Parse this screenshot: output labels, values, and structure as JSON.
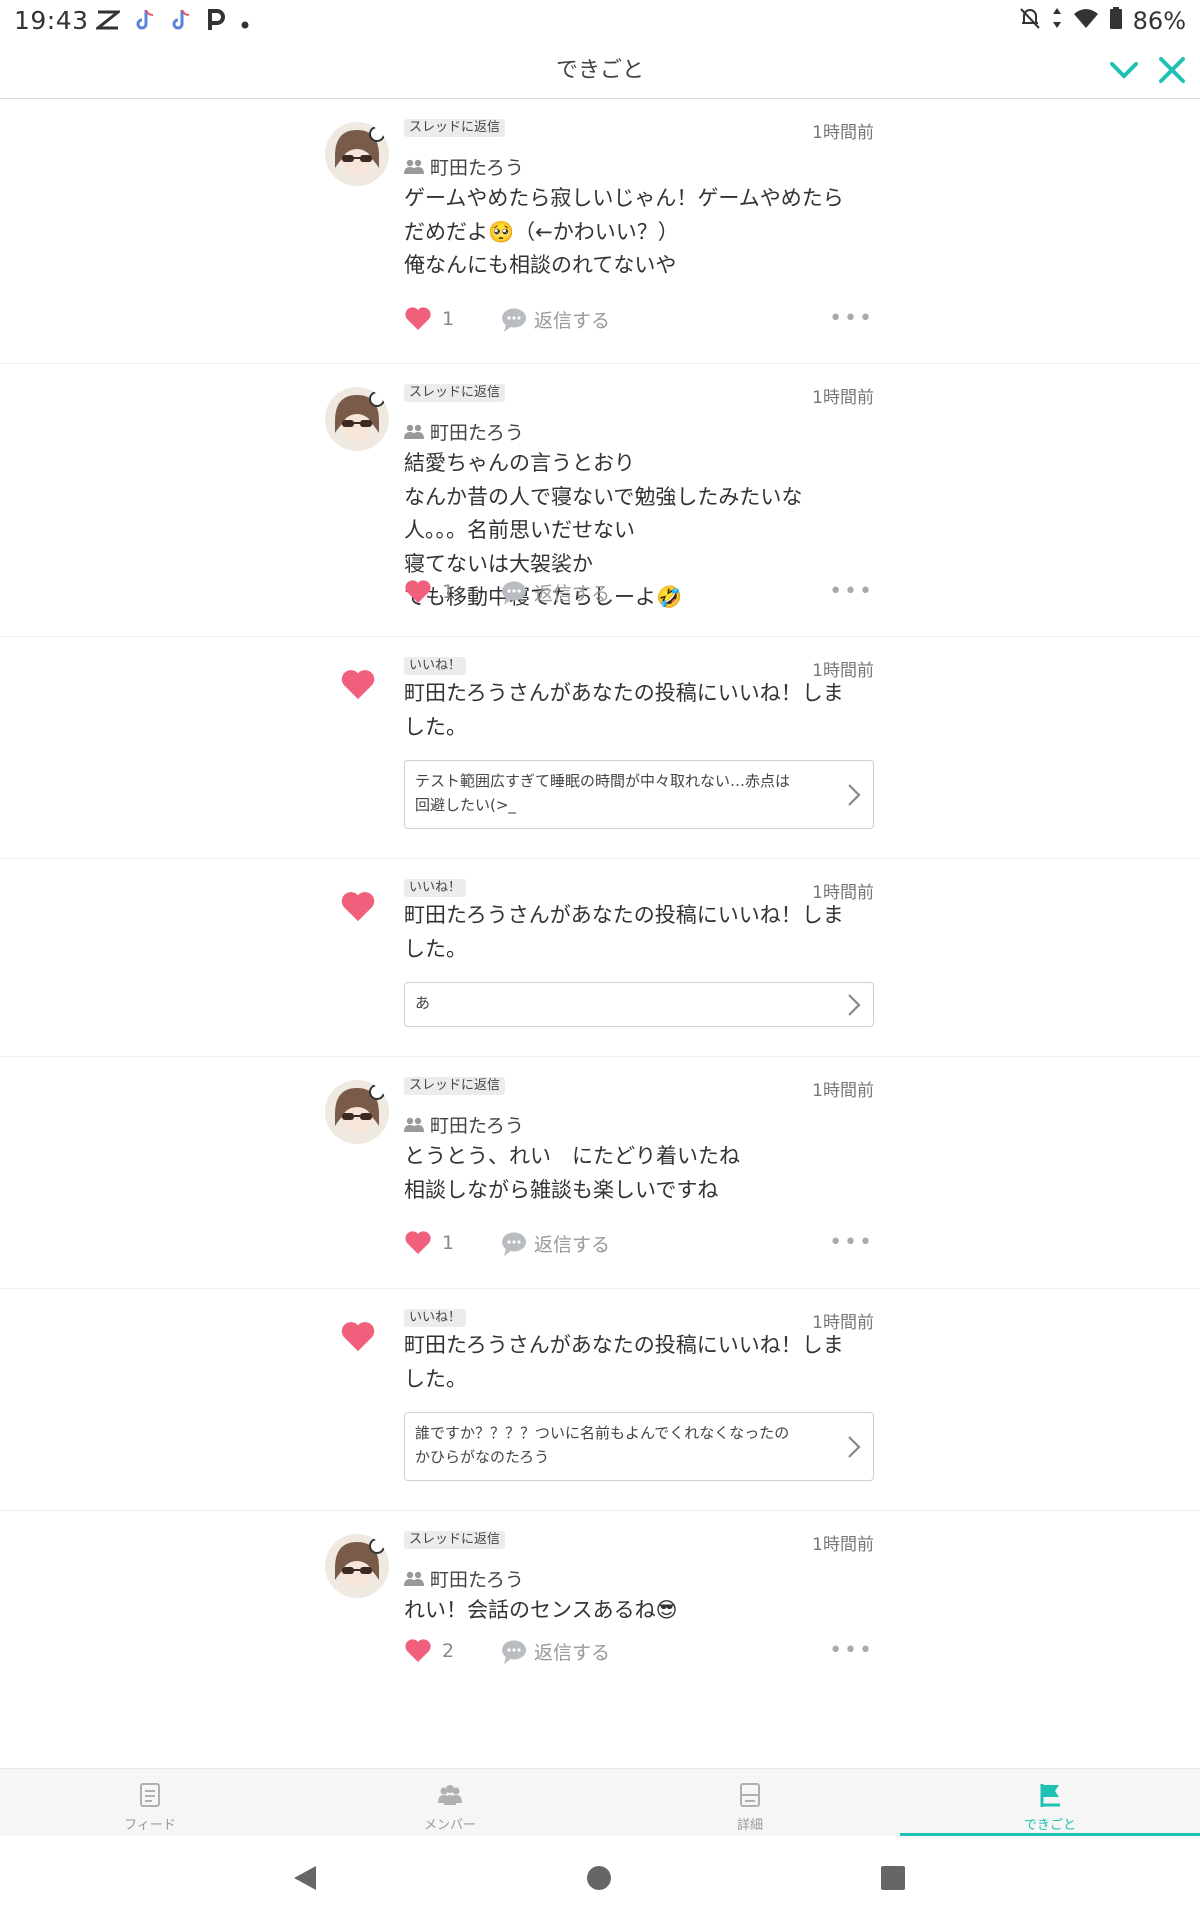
{
  "status": {
    "time": "19:43",
    "battery": "86%",
    "left_icons": [
      "capcut-icon",
      "tiktok-icon",
      "tiktok-icon",
      "p-app-icon",
      "dot"
    ],
    "right_icons": [
      "bell-off-icon",
      "data-arrows-icon",
      "wifi-icon",
      "battery-icon"
    ]
  },
  "header": {
    "title": "できごと",
    "accent": "#1fc1b3"
  },
  "items": [
    {
      "type": "reply",
      "badge": "スレッドに返信",
      "time": "1時間前",
      "user": "町田たろう",
      "body": "ゲームやめたら寂しいじゃん！ゲームやめたら\nだめだよ🥺（←かわいい？）\n俺なんにも相談のれてないや",
      "likes": "1",
      "reply_label": "返信する"
    },
    {
      "type": "reply",
      "badge": "スレッドに返信",
      "time": "1時間前",
      "user": "町田たろう",
      "body": "結愛ちゃんの言うとおり\nなんか昔の人で寝ないで勉強したみたいな\n人。。。名前思いだせない\n寝てないは大袈裟か\nでも移動中寝てたらしーよ🤣",
      "likes": "1",
      "reply_label": "返信する"
    },
    {
      "type": "like",
      "badge": "いいね！",
      "time": "1時間前",
      "body": "町田たろうさんがあなたの投稿にいいね！しま\nした。",
      "quote": "テスト範囲広すぎて睡眠の時間が中々取れない…赤点は\n回避したい(>_"
    },
    {
      "type": "like",
      "badge": "いいね！",
      "time": "1時間前",
      "body": "町田たろうさんがあなたの投稿にいいね！しま\nした。",
      "quote": "あ"
    },
    {
      "type": "reply",
      "badge": "スレッドに返信",
      "time": "1時間前",
      "user": "町田たろう",
      "body": "とうとう、れい　にたどり着いたね\n相談しながら雑談も楽しいですね",
      "likes": "1",
      "reply_label": "返信する"
    },
    {
      "type": "like",
      "badge": "いいね！",
      "time": "1時間前",
      "body": "町田たろうさんがあなたの投稿にいいね！しま\nした。",
      "quote": "誰ですか？？？？ついに名前もよんでくれなくなったの\nかひらがなのたろう"
    },
    {
      "type": "reply",
      "badge": "スレッドに返信",
      "time": "1時間前",
      "user": "町田たろう",
      "body": "れい！会話のセンスあるね😎",
      "likes": "2",
      "reply_label": "返信する"
    }
  ],
  "tabs": [
    {
      "label": "フィード",
      "icon": "feed-icon"
    },
    {
      "label": "メンバー",
      "icon": "members-icon"
    },
    {
      "label": "詳細",
      "icon": "details-icon"
    },
    {
      "label": "できごと",
      "icon": "flag-icon",
      "active": true
    }
  ],
  "colors": {
    "heart": "#f0607c",
    "accent": "#1fc1b3"
  }
}
